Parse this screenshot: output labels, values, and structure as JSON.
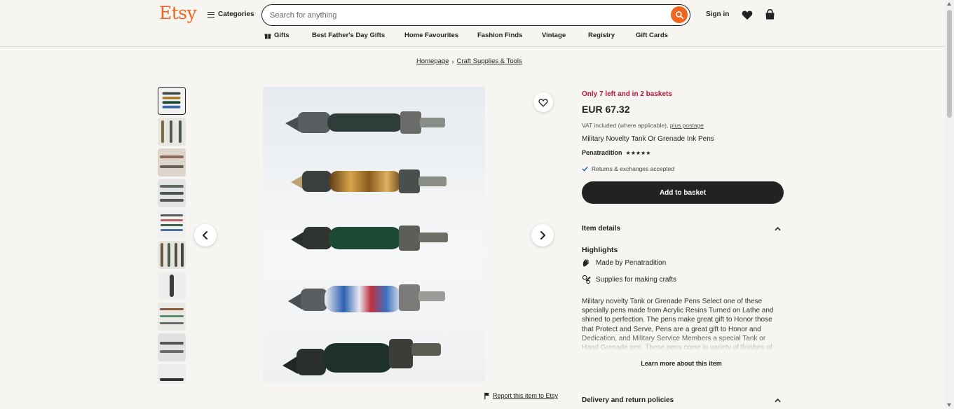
{
  "header": {
    "logo": "Etsy",
    "categories_label": "Categories",
    "search_placeholder": "Search for anything",
    "signin_label": "Sign in"
  },
  "nav": {
    "items": [
      "Gifts",
      "Best Father's Day Gifts",
      "Home Favourites",
      "Fashion Finds",
      "Vintage",
      "Registry",
      "Gift Cards"
    ]
  },
  "breadcrumb": {
    "items": [
      "Homepage",
      "Craft Supplies & Tools"
    ]
  },
  "gallery": {
    "thumbnail_count": 10,
    "selected_index": 0
  },
  "report_label": "Report this item to Etsy",
  "listing": {
    "stock_note": "Only 7 left and in 2 baskets",
    "price": "EUR 67.32",
    "vat_note": "VAT included (where applicable),",
    "postage_link": "plus postage",
    "title": "Military Novelty Tank Or Grenade Ink Pens",
    "shop_name": "Penatradition",
    "rating_stars": "★★★★★",
    "rating_value": 5,
    "returns_note": "Returns & exchanges accepted",
    "add_to_basket": "Add to basket"
  },
  "item_details": {
    "heading": "Item details",
    "highlights_heading": "Highlights",
    "made_by_prefix": "Made by",
    "made_by_shop": "Penatradition",
    "supplies_label": "Supplies for making crafts",
    "description": "Military novelty Tank or Grenade Pens Select one of these specially pens made from Acrylic Resins Turned on Lathe and shined to perfection. The pens make great gift to Honor those that Protect and Serve, Pens are a great gift to Honor and Dedication, and Military Service Members a special Tank or Hand Grenade pen. These pens come in variety of finishes of",
    "learn_more": "Learn more about this item"
  },
  "delivery": {
    "heading": "Delivery and return policies"
  },
  "colors": {
    "brand": "#f1641e",
    "stock_alert": "#b5173b",
    "button": "#222222"
  }
}
